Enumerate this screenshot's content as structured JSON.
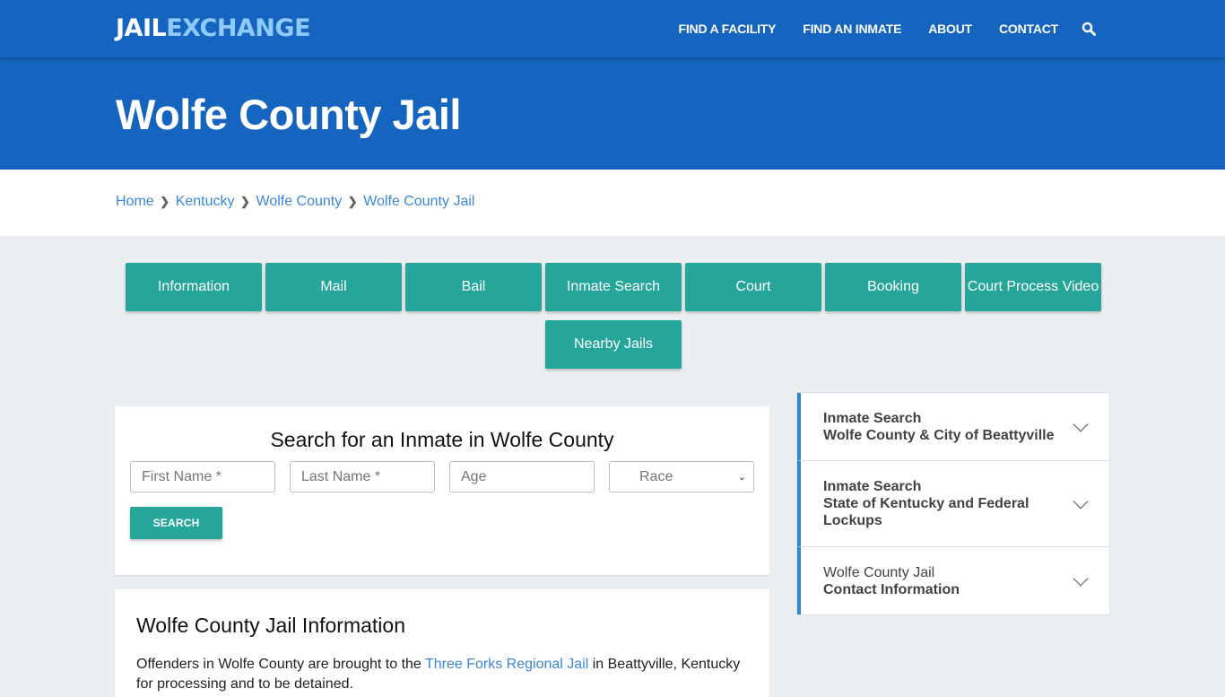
{
  "header": {
    "logo": {
      "part1": "JAIL",
      "part2": "EXCHANGE"
    },
    "nav": [
      {
        "label": "FIND A FACILITY"
      },
      {
        "label": "FIND AN INMATE"
      },
      {
        "label": "ABOUT"
      },
      {
        "label": "CONTACT"
      }
    ],
    "search_icon": "search-icon"
  },
  "hero": {
    "title": "Wolfe County Jail"
  },
  "breadcrumb": [
    {
      "label": "Home"
    },
    {
      "label": "Kentucky"
    },
    {
      "label": "Wolfe County"
    },
    {
      "label": "Wolfe County Jail"
    }
  ],
  "tabs": [
    {
      "label": "Information"
    },
    {
      "label": "Mail"
    },
    {
      "label": "Bail"
    },
    {
      "label": "Inmate Search"
    },
    {
      "label": "Court"
    },
    {
      "label": "Booking"
    },
    {
      "label": "Court Process Video"
    },
    {
      "label": "Nearby Jails"
    }
  ],
  "search_form": {
    "title": "Search for an Inmate in Wolfe County",
    "first_name_placeholder": "First Name *",
    "last_name_placeholder": "Last Name *",
    "age_placeholder": "Age",
    "race_selected": "Race",
    "button_label": "SEARCH"
  },
  "info": {
    "title": "Wolfe County Jail Information",
    "text_before": "Offenders in Wolfe County are brought to the ",
    "link": "Three Forks Regional Jail",
    "text_after": " in Beattyville, Kentucky for processing and to be detained."
  },
  "sidebar": [
    {
      "line1": "Inmate Search",
      "line2": "Wolfe County & City of Beattyville"
    },
    {
      "line1": "Inmate Search",
      "line2": "State of Kentucky and Federal Lockups"
    },
    {
      "line1": "Wolfe County Jail",
      "line2": "Contact Information"
    }
  ],
  "colors": {
    "primary_blue": "#1565c0",
    "teal": "#26a69a",
    "link_blue": "#3a87d6",
    "accent_border": "#2f86d8",
    "background": "#eceff1"
  }
}
